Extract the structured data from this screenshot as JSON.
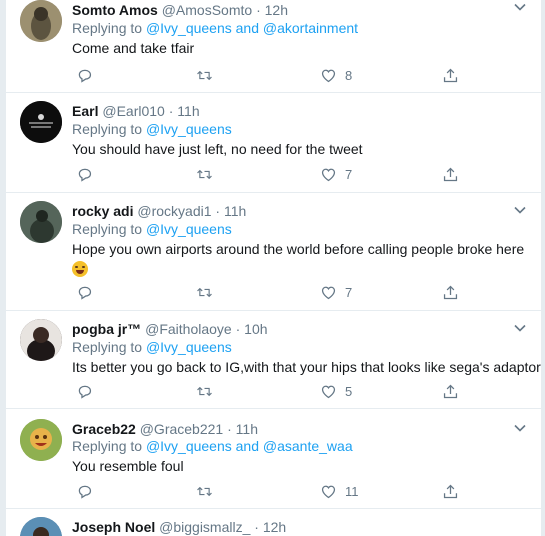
{
  "tweets": [
    {
      "name": "Somto Amos",
      "handle": "@AmosSomto",
      "time": "12h",
      "reply_prefix": "Replying to ",
      "reply_to": "@Ivy_queens and @akortainment",
      "text": "Come and take tfair",
      "likes": "8",
      "avatar_color": "#8a7d62"
    },
    {
      "name": "Earl",
      "handle": "@Earl010",
      "time": "11h",
      "reply_prefix": "Replying to ",
      "reply_to": "@Ivy_queens",
      "text": "You should have just left, no need for the tweet",
      "likes": "7",
      "avatar_color": "#111111"
    },
    {
      "name": "rocky adi",
      "handle": "@rockyadi1",
      "time": "11h",
      "reply_prefix": "Replying to ",
      "reply_to": "@Ivy_queens",
      "text": "Hope you own airports around the world before calling people broke here",
      "likes": "7",
      "avatar_color": "#4a5a4e"
    },
    {
      "name": "pogba jr™",
      "handle": "@Faitholaoye",
      "time": "10h",
      "reply_prefix": "Replying to ",
      "reply_to": "@Ivy_queens",
      "text": "Its better you go back to IG,with that your hips that looks like sega's adaptor",
      "likes": "5",
      "avatar_color": "#2a2020"
    },
    {
      "name": "Graceb22",
      "handle": "@Graceb221",
      "time": "11h",
      "reply_prefix": "Replying to ",
      "reply_to": "@Ivy_queens and @asante_waa",
      "text": "You resemble foul",
      "likes": "11",
      "avatar_color": "#6f8f3a"
    },
    {
      "name": "Joseph Noel",
      "handle": "@biggismallz_",
      "time": "12h",
      "avatar_color": "#3d6f95"
    }
  ],
  "colors": {
    "link": "#1da1f2",
    "muted": "#657786",
    "background": "#e6ecf0"
  },
  "icons": [
    "reply-icon",
    "retweet-icon",
    "like-icon",
    "share-icon",
    "caret-down-icon"
  ]
}
